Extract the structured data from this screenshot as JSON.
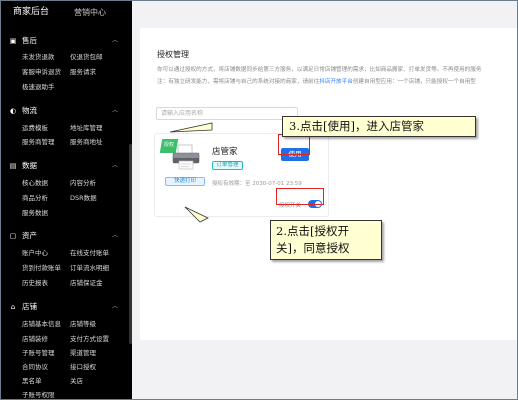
{
  "header": {
    "tab_active": "商家后台",
    "tab_other": "营销中心"
  },
  "sidebar": {
    "sections": [
      {
        "title": "售后",
        "items": [
          "未发货退款",
          "仅退货包邮",
          "客服申诉退货",
          "服务请求",
          "极速退助手"
        ]
      },
      {
        "title": "物流",
        "items": [
          "运费模板",
          "地址库管理",
          "服务商管理",
          "服务商地址"
        ]
      },
      {
        "title": "数据",
        "items": [
          "核心数据",
          "内容分析",
          "商品分析",
          "DSR数据",
          "服务数据"
        ]
      },
      {
        "title": "资产",
        "items": [
          "账户中心",
          "在线支付账单",
          "货到付款账单",
          "订单流水明细",
          "历史报表",
          "店铺保证金"
        ]
      },
      {
        "title": "店铺",
        "items": [
          "店铺基本信息",
          "店铺等级",
          "店铺装修",
          "支付方式设置",
          "子账号管理",
          "渠道管理",
          "合同协议",
          "接口授权",
          "黑名单",
          "关店",
          "子账号权限"
        ]
      }
    ]
  },
  "main": {
    "title": "授权管理",
    "desc_line1": "你可以通过授权的方式，将店铺数据同步给第三方服务，以满足日常店铺管理的需求，比如商品搬家、打单发货等。不再使用的服务",
    "desc_line2_pre": "注：有独立研发能力，需将店铺与自己的系统对接的商家，请前往",
    "desc_line2_link": "抖店开放平台",
    "desc_line2_post": "创建自用型应用：一个店铺，只能授权一个自用型",
    "search_placeholder": "请输入应用名称"
  },
  "card": {
    "ribbon": "授权",
    "tag": "快递打印",
    "name": "店管家",
    "badge": "订单管理",
    "expire": "授权有效期：至 2030-07-01 23:59",
    "use_button": "使用",
    "toggle_label": "授权开关",
    "toggle_on": true
  },
  "callouts": {
    "step3": "3.点击[使用]，进入店管家",
    "step2_line1": "2.点击[授权开",
    "step2_line2": "关]，同意授权"
  },
  "colors": {
    "accent": "#1e6fe8",
    "highlight": "#e02424",
    "callout_bg": "#ffffd2",
    "sidebar_bg": "#000000"
  }
}
